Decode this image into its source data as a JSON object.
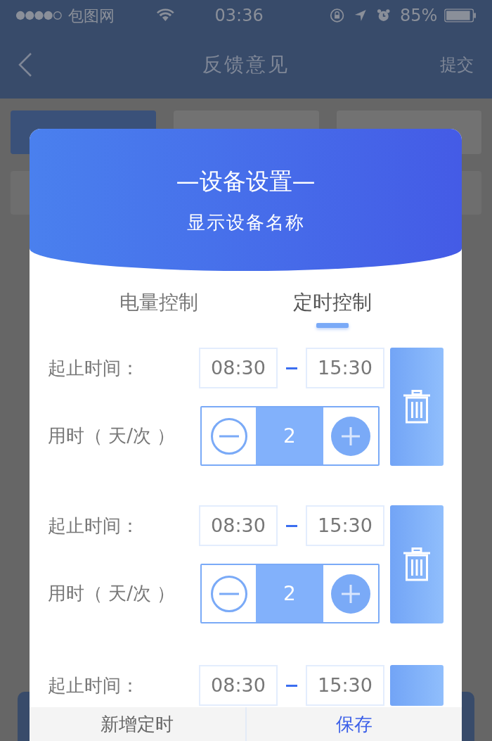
{
  "status_bar": {
    "carrier": "包图网",
    "time": "03:36",
    "battery": "85%"
  },
  "nav_bar": {
    "title": "反馈意见",
    "action": "提交"
  },
  "dialog": {
    "title": "—设备设置—",
    "subtitle": "显示设备名称",
    "tabs": [
      {
        "label": "电量控制",
        "selected": false
      },
      {
        "label": "定时控制",
        "selected": true
      }
    ],
    "timers": [
      {
        "time_label": "起止时间：",
        "start": "08:30",
        "end": "15:30",
        "duration_label": "用时（ 天/次 ）",
        "duration": "2"
      },
      {
        "time_label": "起止时间：",
        "start": "08:30",
        "end": "15:30",
        "duration_label": "用时（ 天/次 ）",
        "duration": "2"
      },
      {
        "time_label": "起止时间：",
        "start": "08:30",
        "end": "15:30"
      }
    ],
    "buttons": [
      {
        "label": "新增定时",
        "kind": "secondary"
      },
      {
        "label": "保存",
        "kind": "primary"
      }
    ]
  }
}
